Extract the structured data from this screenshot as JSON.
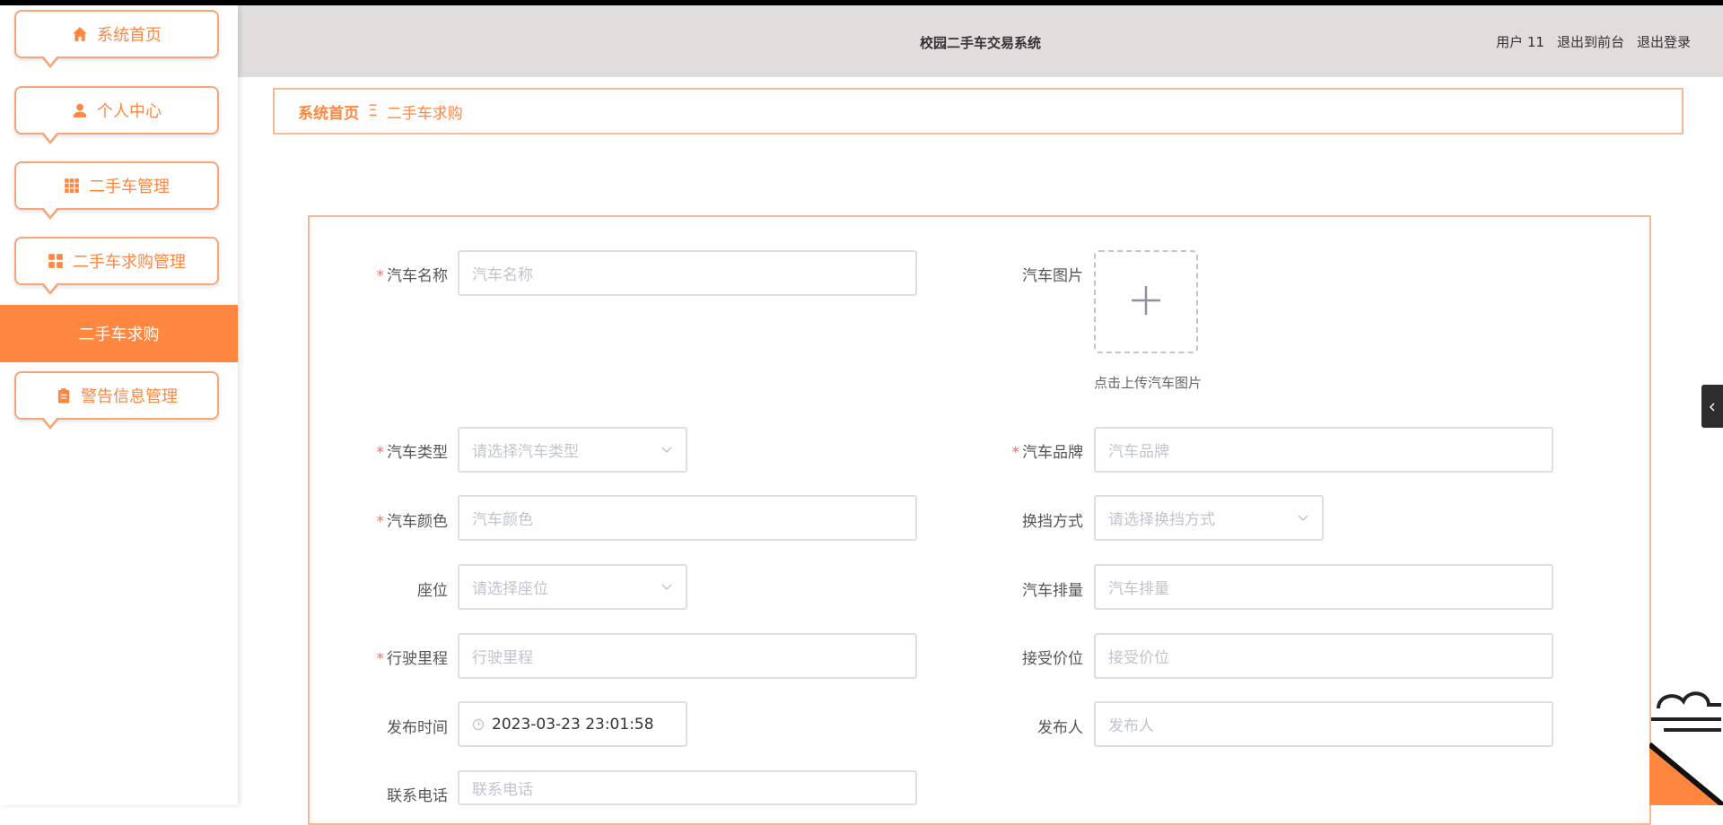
{
  "header": {
    "title": "校园二手车交易系统",
    "user": "用户 11",
    "to_front": "退出到前台",
    "logout": "退出登录"
  },
  "sidebar": {
    "items": [
      {
        "label": "系统首页",
        "icon": "home-icon"
      },
      {
        "label": "个人中心",
        "icon": "user-icon"
      },
      {
        "label": "二手车管理",
        "icon": "grid-icon"
      },
      {
        "label": "二手车求购管理",
        "icon": "apps-icon"
      },
      {
        "label": "警告信息管理",
        "icon": "clipboard-icon"
      }
    ],
    "active_sub": "二手车求购"
  },
  "breadcrumb": {
    "home": "系统首页",
    "separator": "Ξ",
    "current": "二手车求购"
  },
  "form": {
    "car_name": {
      "label": "汽车名称",
      "placeholder": "汽车名称",
      "required": true
    },
    "car_image": {
      "label": "汽车图片",
      "tip": "点击上传汽车图片"
    },
    "car_type": {
      "label": "汽车类型",
      "placeholder": "请选择汽车类型",
      "required": true
    },
    "car_brand": {
      "label": "汽车品牌",
      "placeholder": "汽车品牌",
      "required": true
    },
    "car_color": {
      "label": "汽车颜色",
      "placeholder": "汽车颜色",
      "required": true
    },
    "gearbox": {
      "label": "换挡方式",
      "placeholder": "请选择换挡方式"
    },
    "seats": {
      "label": "座位",
      "placeholder": "请选择座位"
    },
    "displacement": {
      "label": "汽车排量",
      "placeholder": "汽车排量"
    },
    "mileage": {
      "label": "行驶里程",
      "placeholder": "行驶里程",
      "required": true
    },
    "price": {
      "label": "接受价位",
      "placeholder": "接受价位"
    },
    "publish_time": {
      "label": "发布时间",
      "value": "2023-03-23 23:01:58"
    },
    "publisher": {
      "label": "发布人",
      "placeholder": "发布人"
    },
    "phone": {
      "label": "联系电话",
      "placeholder": "联系电话"
    }
  },
  "colors": {
    "accent": "#ff8740",
    "border": "#f5b995",
    "header_bg": "#e0dddd",
    "required": "#f56c6c"
  }
}
